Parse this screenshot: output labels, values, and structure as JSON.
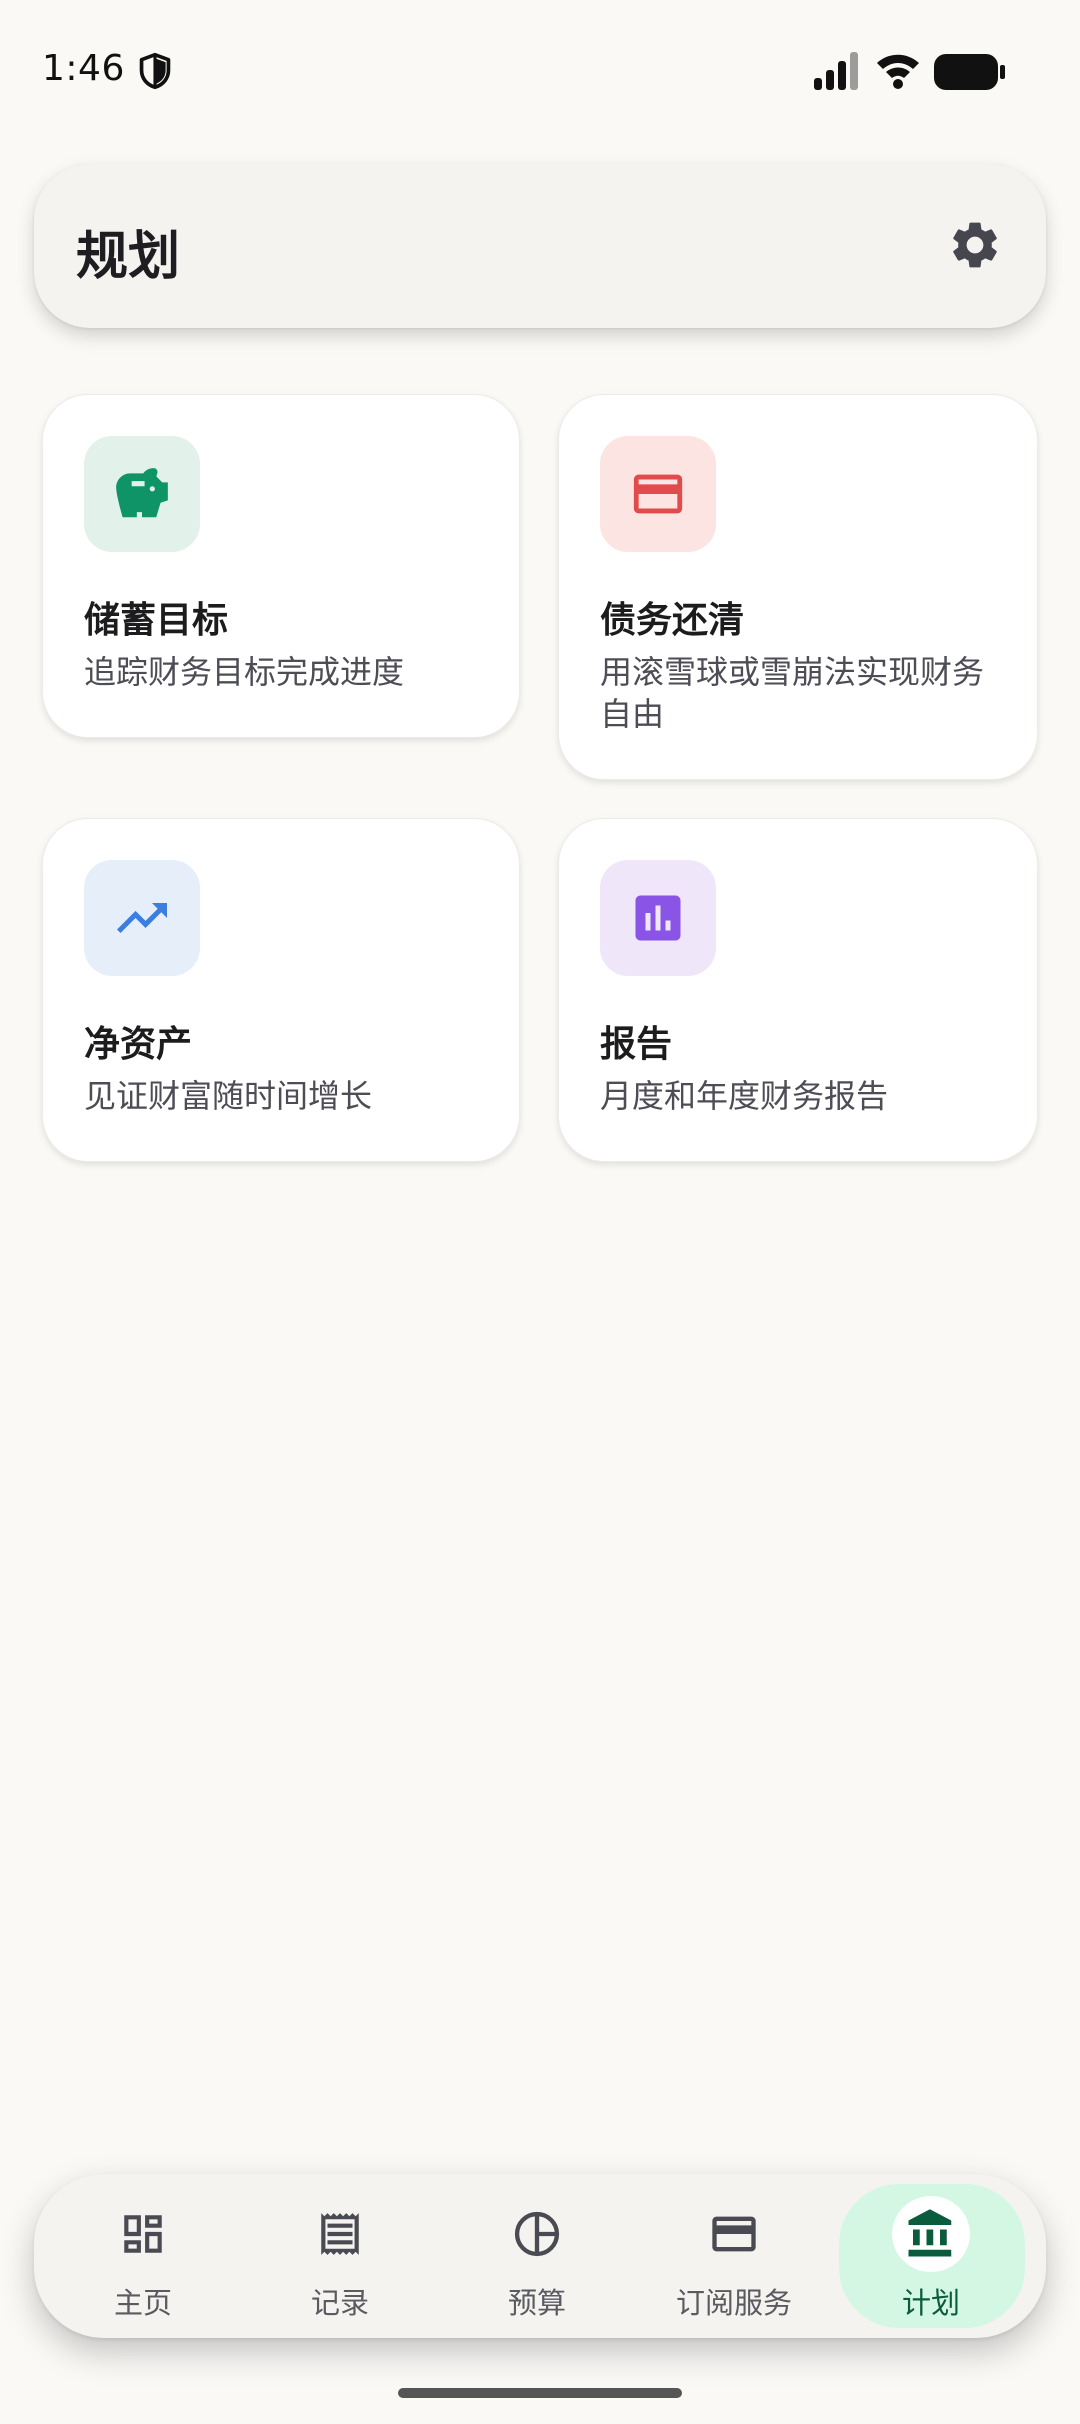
{
  "status_bar": {
    "time": "1:46",
    "icons": [
      "shield-icon",
      "signal-icon",
      "wifi-icon",
      "battery-icon"
    ]
  },
  "header": {
    "title": "规划",
    "settings_icon": "gear-icon"
  },
  "cards": [
    {
      "id": "savings",
      "title": "储蓄目标",
      "description": "追踪财务目标完成进度",
      "icon": "piggy-bank-icon",
      "icon_color": "#0E9466",
      "bg_color": "#E2F1E9"
    },
    {
      "id": "debt",
      "title": "债务还清",
      "description": "用滚雪球或雪崩法实现财务自由",
      "icon": "credit-card-icon",
      "icon_color": "#E14B4B",
      "bg_color": "#FBE4E2"
    },
    {
      "id": "net-worth",
      "title": "净资产",
      "description": "见证财富随时间增长",
      "icon": "trending-up-icon",
      "icon_color": "#3C7DE0",
      "bg_color": "#E6EEFA"
    },
    {
      "id": "reports",
      "title": "报告",
      "description": "月度和年度财务报告",
      "icon": "bar-chart-icon",
      "icon_color": "#8A54E6",
      "bg_color": "#EFE6FA"
    }
  ],
  "bottom_nav": {
    "items": [
      {
        "label": "主页",
        "icon": "dashboard-icon",
        "active": false
      },
      {
        "label": "记录",
        "icon": "receipt-icon",
        "active": false
      },
      {
        "label": "预算",
        "icon": "pie-chart-icon",
        "active": false
      },
      {
        "label": "订阅服务",
        "icon": "card-icon",
        "active": false
      },
      {
        "label": "计划",
        "icon": "bank-icon",
        "active": true
      }
    ],
    "active_color": "#0A5C3D",
    "active_bg": "#D4F7E4"
  }
}
